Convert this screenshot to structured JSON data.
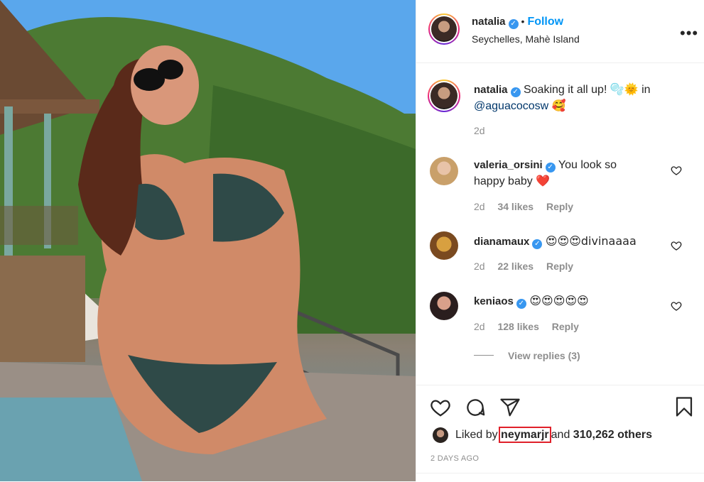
{
  "post": {
    "author": "natalia",
    "location": "Seychelles, Mahè Island",
    "follow_label": "Follow",
    "more_label": "•••",
    "caption": {
      "username": "natalia",
      "text": "Soaking it all up! 🫧🌞 in",
      "mention": "@aguacocosw",
      "emoji_end": "🥰",
      "time": "2d"
    },
    "comments": [
      {
        "username": "valeria_orsini",
        "text": "You look so",
        "text2": "happy baby",
        "emoji": "❤️",
        "time": "2d",
        "likes": "34 likes",
        "reply": "Reply"
      },
      {
        "username": "dianamaux",
        "text": "😍😍😍divinaaaa",
        "time": "2d",
        "likes": "22 likes",
        "reply": "Reply"
      },
      {
        "username": "keniaos",
        "text": "😍😍😍😍😍",
        "time": "2d",
        "likes": "128 likes",
        "reply": "Reply"
      }
    ],
    "view_replies": "View replies (3)",
    "liked_by_prefix": "Liked by",
    "liked_by_user": "neymarjr",
    "liked_by_and": "and",
    "liked_by_count": "310,262 others",
    "timestamp": "2 DAYS AGO"
  },
  "icons": [
    "verified-icon",
    "heart-icon",
    "comment-icon",
    "share-icon",
    "bookmark-icon",
    "more-icon"
  ],
  "colors": {
    "accent": "#0095f6",
    "verified": "#3897f0",
    "heart_red": "#ed4956",
    "highlight": "#e0202a"
  }
}
